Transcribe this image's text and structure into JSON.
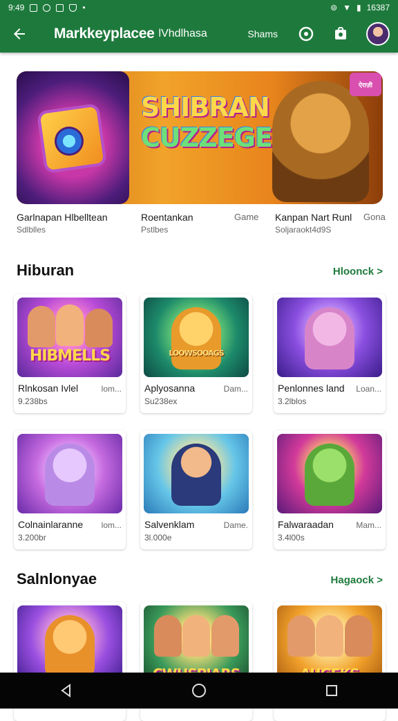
{
  "status_bar": {
    "time": "9:49",
    "battery_text": "16387"
  },
  "app_bar": {
    "title": "Markkeyplacee",
    "subtitle": "lVhdlhasa",
    "share_label": "Shams"
  },
  "banner": {
    "title_line1": "SHIBRAN",
    "title_line2": "CUZZEGE",
    "badge_text": "ऐराज़ी"
  },
  "banner_info": [
    {
      "name": "Garlnapan Hlbelltean",
      "sub": "Sdlblles"
    },
    {
      "name": "Roentankan",
      "sub": "Pstlbes",
      "tag": "Game"
    },
    {
      "name": "Kanpan Nart Runl",
      "sub": "Soljaraokt4d9S",
      "tag": "Gona"
    }
  ],
  "sections": [
    {
      "title": "Hiburan",
      "link": "Hloonck >",
      "cards": [
        {
          "name": "Rlnkosan Ivlel",
          "meta": "lom...",
          "sub": "9.238bs",
          "thumb_text": "HIBMELLS"
        },
        {
          "name": "Aplyosanna",
          "meta": "Dam...",
          "sub": "Su238ex",
          "thumb_text": "LOOWSOOAGS"
        },
        {
          "name": "Penlonnes land",
          "meta": "Loan...",
          "sub": "3.2lblos",
          "thumb_text": ""
        },
        {
          "name": "Colnainlaranne",
          "meta": "lom...",
          "sub": "3.200br",
          "thumb_text": ""
        },
        {
          "name": "Salvenklam",
          "meta": "Dame.",
          "sub": "3l.000e",
          "thumb_text": ""
        },
        {
          "name": "Falwaraadan",
          "meta": "Mam...",
          "sub": "3.4l00s",
          "thumb_text": ""
        }
      ]
    },
    {
      "title": "Salnlonyae",
      "link": "Hagaock >",
      "cards": [
        {
          "thumb_text": ""
        },
        {
          "thumb_text": "CWHSPIARS"
        },
        {
          "thumb_text": "AUGEKS"
        }
      ]
    }
  ]
}
